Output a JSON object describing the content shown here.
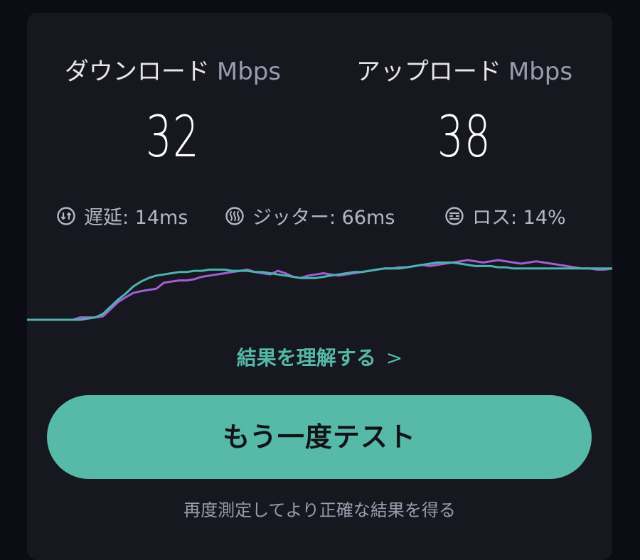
{
  "download": {
    "label": "ダウンロード",
    "unit": "Mbps",
    "value": "32"
  },
  "upload": {
    "label": "アップロード",
    "unit": "Mbps",
    "value": "38"
  },
  "stats": {
    "latency": "遅延: 14ms",
    "jitter": "ジッター: 66ms",
    "loss": "ロス: 14%"
  },
  "link": {
    "label": "結果を理解する",
    "chevron": ">"
  },
  "retest_button": {
    "label": "もう一度テスト"
  },
  "hint": "再度測定してより正確な結果を得る",
  "colors": {
    "download_line": "#a45fd6",
    "upload_line": "#4cb3ae",
    "accent": "#57b9a8"
  },
  "chart_data": {
    "type": "line",
    "series": [
      {
        "values": [
          0,
          0,
          0,
          0,
          0,
          0,
          0,
          4,
          4,
          4,
          6,
          18,
          30,
          38,
          45,
          48,
          50,
          52,
          62,
          64,
          66,
          66,
          68,
          72,
          74,
          76,
          78,
          80,
          82,
          84,
          80,
          78,
          76,
          82,
          78,
          72,
          70,
          74,
          76,
          78,
          76,
          74,
          76,
          78,
          80,
          82,
          84,
          86,
          86,
          88,
          88,
          90,
          92,
          90,
          92,
          94,
          96,
          98,
          100,
          98,
          96,
          98,
          100,
          98,
          96,
          94,
          96,
          98,
          96,
          94,
          92,
          90,
          88,
          86,
          86,
          84,
          84,
          86
        ]
      },
      {
        "values": [
          0,
          0,
          0,
          0,
          0,
          0,
          0,
          0,
          2,
          4,
          10,
          22,
          34,
          44,
          56,
          64,
          70,
          74,
          76,
          78,
          80,
          80,
          82,
          82,
          84,
          84,
          84,
          82,
          82,
          82,
          80,
          80,
          78,
          76,
          74,
          72,
          70,
          70,
          70,
          72,
          74,
          76,
          78,
          80,
          80,
          82,
          84,
          86,
          86,
          86,
          88,
          90,
          92,
          94,
          96,
          96,
          96,
          94,
          92,
          90,
          90,
          90,
          88,
          88,
          86,
          86,
          86,
          86,
          86,
          86,
          86,
          86,
          86,
          86,
          86,
          86,
          86,
          86
        ]
      }
    ]
  }
}
